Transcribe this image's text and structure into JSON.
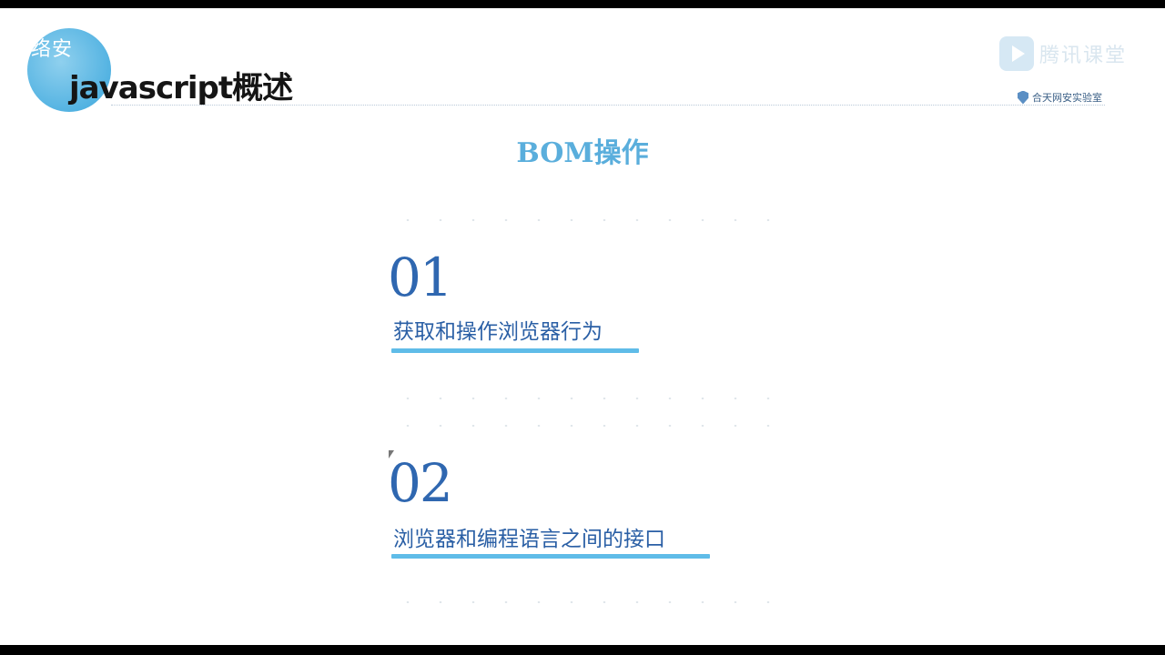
{
  "header": {
    "watermark_text": "络安",
    "title": "javascript概述"
  },
  "logo": {
    "top_text": "腾讯课堂",
    "bottom_text": "合天网安实验室"
  },
  "section": {
    "title": "BOM操作"
  },
  "items": [
    {
      "number": "01",
      "text": "获取和操作浏览器行为"
    },
    {
      "number": "02",
      "text": "浏览器和编程语言之间的接口"
    }
  ]
}
